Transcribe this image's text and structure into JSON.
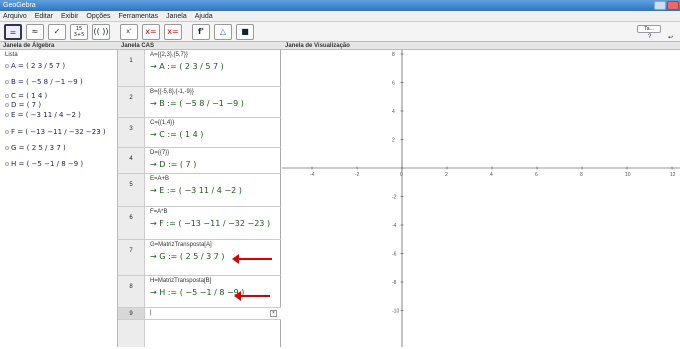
{
  "app": {
    "title": "GeoGebra"
  },
  "menu": [
    "Arquivo",
    "Editar",
    "Exibir",
    "Opções",
    "Ferramentas",
    "Janela",
    "Ajuda"
  ],
  "toolbar": {
    "tools": [
      "=",
      "≈",
      "✓",
      "15 3+5",
      "(( ))",
      "x'",
      "x=",
      "x=",
      "f'",
      "△",
      "■"
    ],
    "right": [
      "Ta...",
      "?",
      "↩"
    ]
  },
  "panels": {
    "algebra_title": "Janela de Álgebra",
    "cas_title": "Janela CAS",
    "graphics_title": "Janela de Visualização"
  },
  "algebra": {
    "group": "Lista",
    "items": [
      "A = ( 2 3 / 5 7 )",
      "B = ( −5 8 / −1 −9 )",
      "C = ( 1 4 )",
      "D = ( 7 )",
      "E = ( −3 11 / 4 −2 )",
      "F = ( −13 −11 / −32 −23 )",
      "G = ( 2 5 / 3 7 )",
      "H = ( −5 −1 / 8 −9 )"
    ]
  },
  "cas": {
    "rows": [
      {
        "num": "1",
        "input": "A={{2,3},{5,7}}",
        "output": "→ A := ( 2 3 / 5 7 )"
      },
      {
        "num": "2",
        "input": "B={{-5,8},{-1,-9}}",
        "output": "→ B := ( −5 8 / −1 −9 )"
      },
      {
        "num": "3",
        "input": "C={{1,4}}",
        "output": "→ C := ( 1 4 )"
      },
      {
        "num": "4",
        "input": "D={{7}}",
        "output": "→ D := ( 7 )"
      },
      {
        "num": "5",
        "input": "E=A+B",
        "output": "→ E := ( −3 11 / 4 −2 )"
      },
      {
        "num": "6",
        "input": "F=A*B",
        "output": "→ F := ( −13 −11 / −32 −23 )"
      },
      {
        "num": "7",
        "input": "G=MatrizTransposta[A]",
        "output": "→ G := ( 2 5 / 3 7 )"
      },
      {
        "num": "8",
        "input": "H=MatrizTransposta[B]",
        "output": "→ H := ( −5 −1 / 8 −9 )"
      },
      {
        "num": "9",
        "input": "|",
        "output": ""
      }
    ]
  },
  "graphics": {
    "x_ticks": [
      "-4",
      "-2",
      "0",
      "2",
      "4",
      "6",
      "8",
      "10",
      "12"
    ],
    "y_ticks": [
      "8",
      "6",
      "4",
      "2",
      "0",
      "-2",
      "-4",
      "-6",
      "-8",
      "-10"
    ]
  },
  "colors": {
    "accent": "#d00000",
    "cas_output": "#1a5a1a"
  }
}
